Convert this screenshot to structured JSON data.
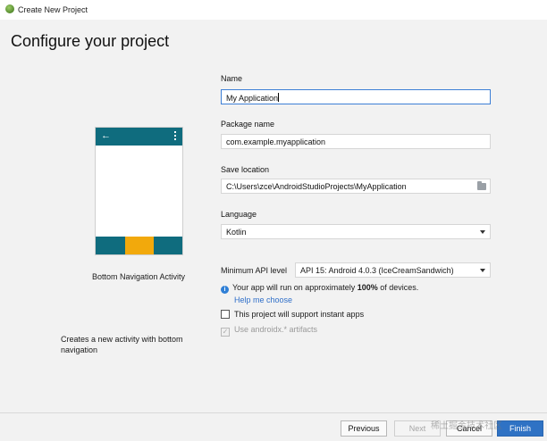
{
  "window": {
    "title": "Create New Project"
  },
  "heading": "Configure your project",
  "preview": {
    "activity_name": "Bottom Navigation Activity",
    "description": "Creates a new activity with bottom navigation",
    "back_glyph": "←"
  },
  "form": {
    "name_label": "Name",
    "name_value": "My Application",
    "package_label": "Package name",
    "package_value": "com.example.myapplication",
    "save_label": "Save location",
    "save_value": "C:\\Users\\zce\\AndroidStudioProjects\\MyApplication",
    "language_label": "Language",
    "language_value": "Kotlin",
    "api_label": "Minimum API level",
    "api_value": "API 15: Android 4.0.3 (IceCreamSandwich)",
    "info_prefix": "Your app will run on approximately ",
    "info_percent": "100%",
    "info_suffix": " of devices.",
    "help_link": "Help me choose",
    "instant_apps_label": "This project will support instant apps",
    "instant_apps_checked": false,
    "androidx_label": "Use androidx.* artifacts",
    "androidx_checked": true
  },
  "footer": {
    "previous": "Previous",
    "next": "Next",
    "cancel": "Cancel",
    "finish": "Finish",
    "watermark": "稀土掘金技术社区"
  },
  "colors": {
    "appbar": "#0f6c7e",
    "bottomnav_selected": "#f2a90c",
    "focus_border": "#3d7fd6",
    "finish_button": "#2f72c4",
    "link": "#2f6fc9"
  }
}
